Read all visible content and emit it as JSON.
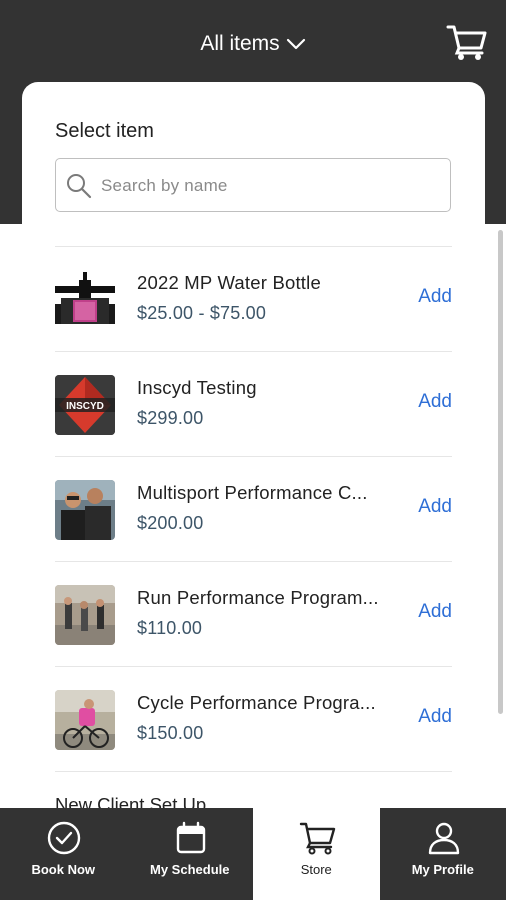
{
  "header": {
    "title": "All items",
    "colors": {
      "bar": "#333333"
    }
  },
  "panel": {
    "heading": "Select item",
    "search": {
      "placeholder": "Search by name"
    }
  },
  "items": [
    {
      "name": "2022 MP Water Bottle",
      "price": "$25.00 - $75.00",
      "action": "Add"
    },
    {
      "name": "Inscyd Testing",
      "price": "$299.00",
      "action": "Add",
      "thumb_text": "INSCYD"
    },
    {
      "name": "Multisport Performance C...",
      "price": "$200.00",
      "action": "Add"
    },
    {
      "name": "Run Performance Program...",
      "price": "$110.00",
      "action": "Add"
    },
    {
      "name": "Cycle Performance Progra...",
      "price": "$150.00",
      "action": "Add"
    }
  ],
  "partial_item": {
    "name": "New Client Set Up"
  },
  "bottom_nav": [
    {
      "label": "Book Now",
      "icon": "check-circle-icon",
      "active": false
    },
    {
      "label": "My Schedule",
      "icon": "calendar-icon",
      "active": false
    },
    {
      "label": "Store",
      "icon": "cart-icon",
      "active": true
    },
    {
      "label": "My Profile",
      "icon": "person-icon",
      "active": false
    }
  ],
  "colors": {
    "accent": "#2f6fd6",
    "price": "#3d5568"
  }
}
